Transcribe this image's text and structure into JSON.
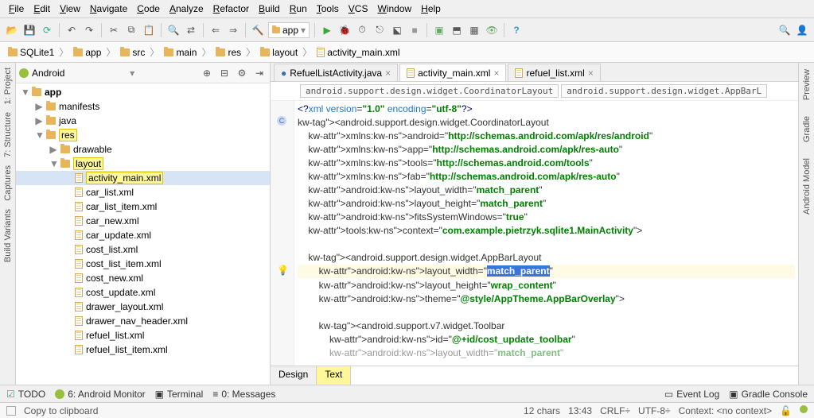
{
  "menu": [
    "File",
    "Edit",
    "View",
    "Navigate",
    "Code",
    "Analyze",
    "Refactor",
    "Build",
    "Run",
    "Tools",
    "VCS",
    "Window",
    "Help"
  ],
  "run_config": "app",
  "breadcrumb": [
    "SQLite1",
    "app",
    "src",
    "main",
    "res",
    "layout",
    "activity_main.xml"
  ],
  "project_view_mode": "Android",
  "left_rail": [
    "1: Project",
    "7: Structure",
    "Captures",
    "Build Variants"
  ],
  "right_rail": [
    "Preview",
    "Gradle",
    "Android Model"
  ],
  "tree": {
    "root": "app",
    "rows": [
      {
        "depth": 0,
        "tw": "▼",
        "icon": "folder",
        "label": "app",
        "bold": true
      },
      {
        "depth": 1,
        "tw": "▶",
        "icon": "folder",
        "label": "manifests"
      },
      {
        "depth": 1,
        "tw": "▶",
        "icon": "folder",
        "label": "java"
      },
      {
        "depth": 1,
        "tw": "▼",
        "icon": "folder",
        "label": "res",
        "hl": true
      },
      {
        "depth": 2,
        "tw": "▶",
        "icon": "folder",
        "label": "drawable"
      },
      {
        "depth": 2,
        "tw": "▼",
        "icon": "folder",
        "label": "layout",
        "hl": true
      },
      {
        "depth": 3,
        "tw": "",
        "icon": "xml",
        "label": "activity_main.xml",
        "hl": true,
        "sel": true
      },
      {
        "depth": 3,
        "tw": "",
        "icon": "xml",
        "label": "car_list.xml"
      },
      {
        "depth": 3,
        "tw": "",
        "icon": "xml",
        "label": "car_list_item.xml"
      },
      {
        "depth": 3,
        "tw": "",
        "icon": "xml",
        "label": "car_new.xml"
      },
      {
        "depth": 3,
        "tw": "",
        "icon": "xml",
        "label": "car_update.xml"
      },
      {
        "depth": 3,
        "tw": "",
        "icon": "xml",
        "label": "cost_list.xml"
      },
      {
        "depth": 3,
        "tw": "",
        "icon": "xml",
        "label": "cost_list_item.xml"
      },
      {
        "depth": 3,
        "tw": "",
        "icon": "xml",
        "label": "cost_new.xml"
      },
      {
        "depth": 3,
        "tw": "",
        "icon": "xml",
        "label": "cost_update.xml"
      },
      {
        "depth": 3,
        "tw": "",
        "icon": "xml",
        "label": "drawer_layout.xml"
      },
      {
        "depth": 3,
        "tw": "",
        "icon": "xml",
        "label": "drawer_nav_header.xml"
      },
      {
        "depth": 3,
        "tw": "",
        "icon": "xml",
        "label": "refuel_list.xml"
      },
      {
        "depth": 3,
        "tw": "",
        "icon": "xml",
        "label": "refuel_list_item.xml"
      }
    ]
  },
  "editor_tabs": [
    {
      "label": "RefuelListActivity.java",
      "active": false,
      "icon": "java"
    },
    {
      "label": "activity_main.xml",
      "active": true,
      "icon": "xml"
    },
    {
      "label": "refuel_list.xml",
      "active": false,
      "icon": "xml"
    }
  ],
  "editor_breadcrumb": [
    "android.support.design.widget.CoordinatorLayout",
    "android.support.design.widget.AppBarL"
  ],
  "code_lines": [
    {
      "raw": "<?xml version=\"1.0\" encoding=\"utf-8\"?>",
      "type": "pi"
    },
    {
      "raw": "<android.support.design.widget.CoordinatorLayout",
      "type": "tag-open",
      "gutter": "C"
    },
    {
      "raw": "    xmlns:android=\"http://schemas.android.com/apk/res/android\"",
      "type": "attr"
    },
    {
      "raw": "    xmlns:app=\"http://schemas.android.com/apk/res-auto\"",
      "type": "attr"
    },
    {
      "raw": "    xmlns:tools=\"http://schemas.android.com/tools\"",
      "type": "attr"
    },
    {
      "raw": "    xmlns:fab=\"http://schemas.android.com/apk/res-auto\"",
      "type": "attr"
    },
    {
      "raw": "    android:layout_width=\"match_parent\"",
      "type": "attr"
    },
    {
      "raw": "    android:layout_height=\"match_parent\"",
      "type": "attr"
    },
    {
      "raw": "    android:fitsSystemWindows=\"true\"",
      "type": "attr"
    },
    {
      "raw": "    tools:context=\"com.example.pietrzyk.sqlite1.MainActivity\">",
      "type": "attr"
    },
    {
      "raw": "",
      "type": "blank"
    },
    {
      "raw": "    <android.support.design.widget.AppBarLayout",
      "type": "tag-open"
    },
    {
      "raw": "        android:layout_width=\"match_parent\"",
      "type": "attr",
      "hl": true,
      "sel": "match_parent",
      "bulb": true
    },
    {
      "raw": "        android:layout_height=\"wrap_content\"",
      "type": "attr"
    },
    {
      "raw": "        android:theme=\"@style/AppTheme.AppBarOverlay\">",
      "type": "attr"
    },
    {
      "raw": "",
      "type": "blank"
    },
    {
      "raw": "        <android.support.v7.widget.Toolbar",
      "type": "tag-open"
    },
    {
      "raw": "            android:id=\"@+id/cost_update_toolbar\"",
      "type": "attr"
    },
    {
      "raw": "            android:layout_width=\"match_parent\"",
      "type": "attr",
      "faded": true
    }
  ],
  "footer_tabs": {
    "design": "Design",
    "text": "Text"
  },
  "bottom_tools": [
    "TODO",
    "6: Android Monitor",
    "Terminal",
    "0: Messages"
  ],
  "bottom_right": [
    "Event Log",
    "Gradle Console"
  ],
  "status": {
    "msg": "Copy to clipboard",
    "chars": "12 chars",
    "time": "13:43",
    "lineend": "CRLF",
    "sep": "÷",
    "enc": "UTF-8",
    "ctx": "Context: <no context>"
  }
}
